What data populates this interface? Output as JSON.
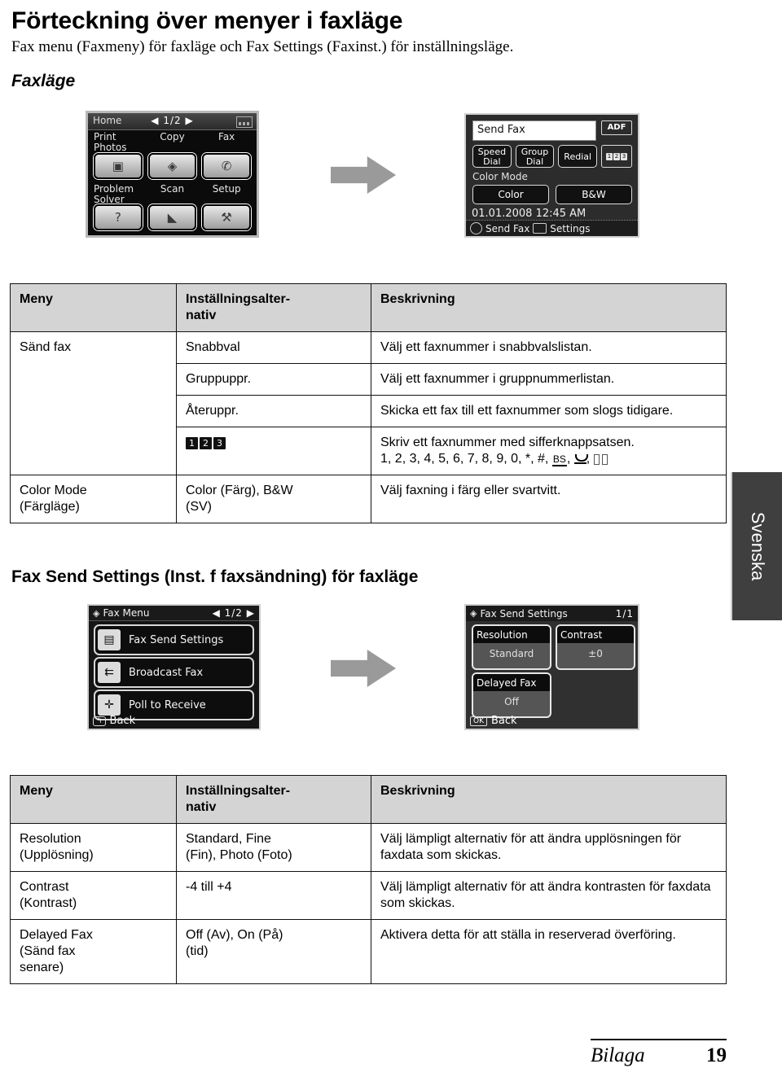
{
  "document": {
    "title": "Förteckning över menyer i faxläge",
    "subtitle": "Fax menu (Faxmeny) för faxläge och Fax Settings (Faxinst.) för inställningsläge.",
    "section1_heading": "Faxläge",
    "section2_heading": "Fax Send Settings (Inst. f faxsändning) för faxläge",
    "side_tab": "Svenska",
    "footer": {
      "label": "Bilaga",
      "page": "19"
    }
  },
  "lcd_home": {
    "titlebar": "Home",
    "page_indicator": "1/2",
    "prev_arrow": "◀",
    "next_arrow": "▶",
    "network_icon": "network-icon",
    "tiles": [
      {
        "label": "Print\nPhotos",
        "icon": "photo-icon",
        "glyph": "▣"
      },
      {
        "label": "Copy",
        "icon": "copy-icon",
        "glyph": "◈"
      },
      {
        "label": "Fax",
        "icon": "fax-icon",
        "glyph": "✆"
      },
      {
        "label": "Problem\nSolver",
        "icon": "help-icon",
        "glyph": "?"
      },
      {
        "label": "Scan",
        "icon": "scan-icon",
        "glyph": "◣"
      },
      {
        "label": "Setup",
        "icon": "tools-icon",
        "glyph": "⚒"
      }
    ]
  },
  "lcd_send_fax": {
    "field_value": "Send Fax",
    "adf_badge": "ADF",
    "buttons": [
      "Speed\nDial",
      "Group\nDial",
      "Redial"
    ],
    "keypad_keys": [
      "1",
      "2",
      "3"
    ],
    "color_mode_label": "Color Mode",
    "color_buttons": [
      "Color",
      "B&W"
    ],
    "timestamp": "01.01.2008 12:45 AM",
    "footer_send": "Send Fax",
    "footer_settings": "Settings"
  },
  "lcd_fax_menu": {
    "title": "Fax Menu",
    "page_indicator": "1/2",
    "prev_arrow": "◀",
    "next_arrow": "▶",
    "items": [
      {
        "label": "Fax Send Settings",
        "icon": "fax-send-settings-icon",
        "glyph": "▤"
      },
      {
        "label": "Broadcast Fax",
        "icon": "broadcast-fax-icon",
        "glyph": "⇇"
      },
      {
        "label": "Poll to Receive",
        "icon": "poll-to-receive-icon",
        "glyph": "✛"
      }
    ],
    "back_label": "Back",
    "back_badge": "↰"
  },
  "lcd_fax_send_settings": {
    "title": "Fax Send Settings",
    "page_indicator": "1/1",
    "cards": [
      {
        "name": "Resolution",
        "value": "Standard"
      },
      {
        "name": "Contrast",
        "value": "±0"
      },
      {
        "name": "Delayed Fax",
        "value": "Off"
      }
    ],
    "back_label": "Back",
    "back_badge": "OK"
  },
  "table1": {
    "headers": [
      "Meny",
      "Inställningsalternativ",
      "Beskrivning"
    ],
    "rows": [
      {
        "menu": "Sänd fax",
        "option": "Snabbval",
        "description": "Välj ett faxnummer i snabbvalslistan."
      },
      {
        "menu": "",
        "option": "Gruppuppr.",
        "description": "Välj ett faxnummer i gruppnummerlistan."
      },
      {
        "menu": "",
        "option": "Återuppr.",
        "description": "Skicka ett fax till ett faxnummer som slogs tidigare."
      },
      {
        "menu": "",
        "option": "keypad-123-icon",
        "description_line1": "Skriv ett faxnummer med sifferknappsatsen.",
        "description_line2": "1, 2, 3, 4, 5, 6, 7, 8, 9, 0, *, #,"
      },
      {
        "menu": "Color Mode (Färgläge)",
        "option": "Color (Färg), B&W (SV)",
        "description": "Välj faxning i färg eller svartvitt."
      }
    ]
  },
  "table2": {
    "headers": [
      "Meny",
      "Inställningsalternativ",
      "Beskrivning"
    ],
    "rows": [
      {
        "menu": "Resolution (Upplösning)",
        "option": "Standard, Fine (Fin), Photo (Foto)",
        "description": "Välj lämpligt alternativ för att ändra upplösningen för faxdata som skickas."
      },
      {
        "menu": "Contrast (Kontrast)",
        "option": "-4 till +4",
        "description": "Välj lämpligt alternativ för att ändra kontrasten för faxdata som skickas."
      },
      {
        "menu": "Delayed Fax (Sänd fax senare)",
        "option": "Off (Av), On (På) (tid)",
        "description": "Aktivera detta för att ställa in reserverad överföring."
      }
    ]
  },
  "colors": {
    "header_bg": "#d4d4d4",
    "side_tab_bg": "#3f3f3f",
    "arrow": "#9a9a9a"
  }
}
